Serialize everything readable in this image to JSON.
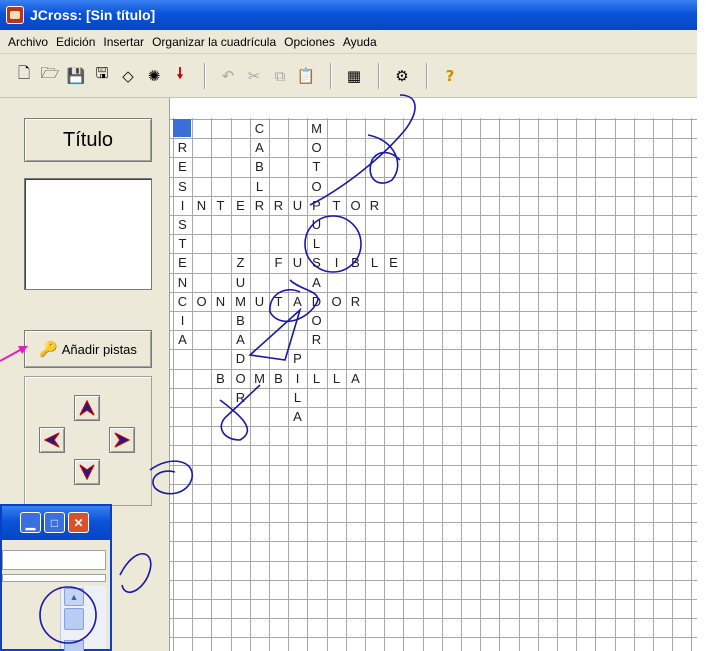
{
  "window": {
    "title": "JCross: [Sin título]"
  },
  "menu": [
    "Archivo",
    "Edición",
    "Insertar",
    "Organizar la cuadrícula",
    "Opciones",
    "Ayuda"
  ],
  "toolbar": [
    {
      "icon": "new-file-icon",
      "glyph": "🗋"
    },
    {
      "icon": "open-folder-icon",
      "glyph": "🗁"
    },
    {
      "icon": "save-icon",
      "glyph": "💾"
    },
    {
      "icon": "save-as-icon",
      "glyph": "🖫"
    },
    {
      "icon": "eraser-icon",
      "glyph": "◇"
    },
    {
      "icon": "web-page-icon",
      "glyph": "✺"
    },
    {
      "icon": "export-arrow-icon",
      "glyph": "🠗"
    },
    {
      "sep": true
    },
    {
      "icon": "undo-icon",
      "glyph": "↶",
      "disabled": true
    },
    {
      "icon": "cut-icon",
      "glyph": "✂",
      "disabled": true
    },
    {
      "icon": "copy-icon",
      "glyph": "⧉",
      "disabled": true
    },
    {
      "icon": "paste-icon",
      "glyph": "📋",
      "disabled": true
    },
    {
      "sep": true
    },
    {
      "icon": "grid-maker-icon",
      "glyph": "▦"
    },
    {
      "sep": true
    },
    {
      "icon": "configuration-icon",
      "glyph": "⚙"
    },
    {
      "sep": true
    },
    {
      "icon": "help-icon",
      "glyph": "?"
    }
  ],
  "left_panel": {
    "title_label": "Título",
    "title_value": "",
    "clues_button": "Añadir pistas"
  },
  "grid": {
    "cols": 28,
    "rows": 28,
    "selected": {
      "row": 0,
      "col": 0
    },
    "cells": [
      {
        "r": 0,
        "c": 4,
        "t": "C"
      },
      {
        "r": 0,
        "c": 7,
        "t": "M"
      },
      {
        "r": 1,
        "c": 0,
        "t": "R"
      },
      {
        "r": 1,
        "c": 4,
        "t": "A"
      },
      {
        "r": 1,
        "c": 7,
        "t": "O"
      },
      {
        "r": 2,
        "c": 0,
        "t": "E"
      },
      {
        "r": 2,
        "c": 4,
        "t": "B"
      },
      {
        "r": 2,
        "c": 7,
        "t": "T"
      },
      {
        "r": 3,
        "c": 0,
        "t": "S"
      },
      {
        "r": 3,
        "c": 4,
        "t": "L"
      },
      {
        "r": 3,
        "c": 7,
        "t": "O"
      },
      {
        "r": 4,
        "c": 0,
        "t": "I"
      },
      {
        "r": 4,
        "c": 1,
        "t": "N"
      },
      {
        "r": 4,
        "c": 2,
        "t": "T"
      },
      {
        "r": 4,
        "c": 3,
        "t": "E"
      },
      {
        "r": 4,
        "c": 4,
        "t": "R"
      },
      {
        "r": 4,
        "c": 5,
        "t": "R"
      },
      {
        "r": 4,
        "c": 6,
        "t": "U"
      },
      {
        "r": 4,
        "c": 7,
        "t": "P"
      },
      {
        "r": 4,
        "c": 8,
        "t": "T"
      },
      {
        "r": 4,
        "c": 9,
        "t": "O"
      },
      {
        "r": 4,
        "c": 10,
        "t": "R"
      },
      {
        "r": 5,
        "c": 0,
        "t": "S"
      },
      {
        "r": 5,
        "c": 7,
        "t": "U"
      },
      {
        "r": 6,
        "c": 0,
        "t": "T"
      },
      {
        "r": 6,
        "c": 7,
        "t": "L"
      },
      {
        "r": 7,
        "c": 0,
        "t": "E"
      },
      {
        "r": 7,
        "c": 3,
        "t": "Z"
      },
      {
        "r": 7,
        "c": 5,
        "t": "F"
      },
      {
        "r": 7,
        "c": 6,
        "t": "U"
      },
      {
        "r": 7,
        "c": 7,
        "t": "S"
      },
      {
        "r": 7,
        "c": 8,
        "t": "I"
      },
      {
        "r": 7,
        "c": 9,
        "t": "B"
      },
      {
        "r": 7,
        "c": 10,
        "t": "L"
      },
      {
        "r": 7,
        "c": 11,
        "t": "E"
      },
      {
        "r": 8,
        "c": 0,
        "t": "N"
      },
      {
        "r": 8,
        "c": 3,
        "t": "U"
      },
      {
        "r": 8,
        "c": 7,
        "t": "A"
      },
      {
        "r": 9,
        "c": 0,
        "t": "C"
      },
      {
        "r": 9,
        "c": 1,
        "t": "O"
      },
      {
        "r": 9,
        "c": 2,
        "t": "N"
      },
      {
        "r": 9,
        "c": 3,
        "t": "M"
      },
      {
        "r": 9,
        "c": 4,
        "t": "U"
      },
      {
        "r": 9,
        "c": 5,
        "t": "T"
      },
      {
        "r": 9,
        "c": 6,
        "t": "A"
      },
      {
        "r": 9,
        "c": 7,
        "t": "D"
      },
      {
        "r": 9,
        "c": 8,
        "t": "O"
      },
      {
        "r": 9,
        "c": 9,
        "t": "R"
      },
      {
        "r": 10,
        "c": 0,
        "t": "I"
      },
      {
        "r": 10,
        "c": 3,
        "t": "B"
      },
      {
        "r": 10,
        "c": 7,
        "t": "O"
      },
      {
        "r": 11,
        "c": 0,
        "t": "A"
      },
      {
        "r": 11,
        "c": 3,
        "t": "A"
      },
      {
        "r": 11,
        "c": 7,
        "t": "R"
      },
      {
        "r": 12,
        "c": 3,
        "t": "D"
      },
      {
        "r": 12,
        "c": 6,
        "t": "P"
      },
      {
        "r": 13,
        "c": 2,
        "t": "B"
      },
      {
        "r": 13,
        "c": 3,
        "t": "O"
      },
      {
        "r": 13,
        "c": 4,
        "t": "M"
      },
      {
        "r": 13,
        "c": 5,
        "t": "B"
      },
      {
        "r": 13,
        "c": 6,
        "t": "I"
      },
      {
        "r": 13,
        "c": 7,
        "t": "L"
      },
      {
        "r": 13,
        "c": 8,
        "t": "L"
      },
      {
        "r": 13,
        "c": 9,
        "t": "A"
      },
      {
        "r": 14,
        "c": 3,
        "t": "R"
      },
      {
        "r": 14,
        "c": 6,
        "t": "L"
      },
      {
        "r": 15,
        "c": 6,
        "t": "A"
      }
    ]
  },
  "watermark": {
    "color": "#1010a0"
  },
  "colors": {
    "accent": "#0a53d8",
    "panel": "#ece9d8",
    "selected_cell": "#3a6fd8",
    "pointer_arrow": "#e020c0"
  }
}
